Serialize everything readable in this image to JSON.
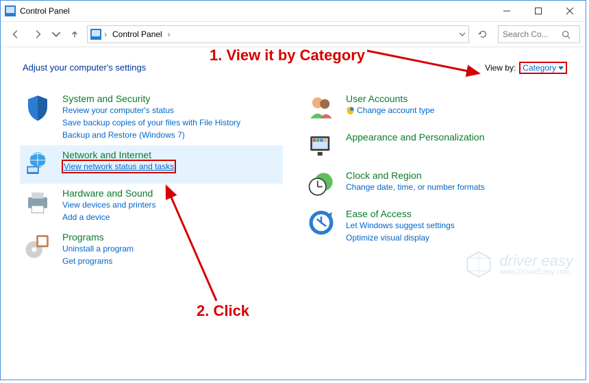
{
  "titlebar": {
    "title": "Control Panel"
  },
  "breadcrumb": {
    "item1": "Control Panel"
  },
  "search": {
    "placeholder": "Search Co..."
  },
  "heading": "Adjust your computer's settings",
  "viewby": {
    "label": "View by:",
    "value": "Category"
  },
  "left": [
    {
      "cat": "System and Security",
      "links": [
        "Review your computer's status",
        "Save backup copies of your files with File History",
        "Backup and Restore (Windows 7)"
      ]
    },
    {
      "cat": "Network and Internet",
      "links": [
        "View network status and tasks"
      ]
    },
    {
      "cat": "Hardware and Sound",
      "links": [
        "View devices and printers",
        "Add a device"
      ]
    },
    {
      "cat": "Programs",
      "links": [
        "Uninstall a program",
        "Get programs"
      ]
    }
  ],
  "right": [
    {
      "cat": "User Accounts",
      "links": [
        "Change account type"
      ]
    },
    {
      "cat": "Appearance and Personalization",
      "links": []
    },
    {
      "cat": "Clock and Region",
      "links": [
        "Change date, time, or number formats"
      ]
    },
    {
      "cat": "Ease of Access",
      "links": [
        "Let Windows suggest settings",
        "Optimize visual display"
      ]
    }
  ],
  "annotations": {
    "a1": "1. View it by Category",
    "a2": "2. Click"
  },
  "watermark": {
    "brand": "driver easy",
    "url": "www.DriverEasy.com"
  }
}
